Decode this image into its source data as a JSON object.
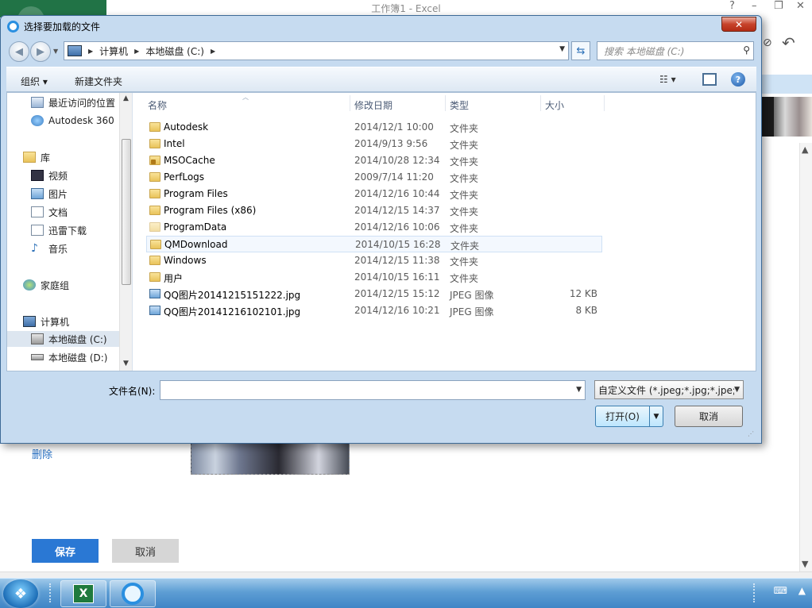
{
  "excel": {
    "title": "工作簿1 - Excel",
    "delete_link": "删除",
    "save_button": "保存",
    "cancel_button": "取消"
  },
  "dialog": {
    "title": "选择要加载的文件",
    "close_glyph": "✕",
    "breadcrumb": [
      "计算机",
      "本地磁盘 (C:)"
    ],
    "search_placeholder": "搜索 本地磁盘 (C:)",
    "toolbar": {
      "organize": "组织 ▾",
      "new_folder": "新建文件夹"
    },
    "nav_items": {
      "recent": "最近访问的位置",
      "autodesk360": "Autodesk 360",
      "libraries": "库",
      "videos": "视频",
      "pictures": "图片",
      "documents": "文档",
      "thunder": "迅雷下载",
      "music": "音乐",
      "homegroup": "家庭组",
      "computer": "计算机",
      "drive_c": "本地磁盘 (C:)",
      "drive_d": "本地磁盘 (D:)"
    },
    "columns": {
      "name": "名称",
      "date": "修改日期",
      "type": "类型",
      "size": "大小"
    },
    "files": [
      {
        "name": "Autodesk",
        "date": "2014/12/1 10:00",
        "type": "文件夹",
        "size": ""
      },
      {
        "name": "Intel",
        "date": "2014/9/13 9:56",
        "type": "文件夹",
        "size": ""
      },
      {
        "name": "MSOCache",
        "date": "2014/10/28 12:34",
        "type": "文件夹",
        "size": ""
      },
      {
        "name": "PerfLogs",
        "date": "2009/7/14 11:20",
        "type": "文件夹",
        "size": ""
      },
      {
        "name": "Program Files",
        "date": "2014/12/16 10:44",
        "type": "文件夹",
        "size": ""
      },
      {
        "name": "Program Files (x86)",
        "date": "2014/12/15 14:37",
        "type": "文件夹",
        "size": ""
      },
      {
        "name": "ProgramData",
        "date": "2014/12/16 10:06",
        "type": "文件夹",
        "size": ""
      },
      {
        "name": "QMDownload",
        "date": "2014/10/15 16:28",
        "type": "文件夹",
        "size": ""
      },
      {
        "name": "Windows",
        "date": "2014/12/15 11:38",
        "type": "文件夹",
        "size": ""
      },
      {
        "name": "用户",
        "date": "2014/10/15 16:11",
        "type": "文件夹",
        "size": ""
      },
      {
        "name": "QQ图片20141215151222.jpg",
        "date": "2014/12/15 15:12",
        "type": "JPEG 图像",
        "size": "12 KB"
      },
      {
        "name": "QQ图片20141216102101.jpg",
        "date": "2014/12/16 10:21",
        "type": "JPEG 图像",
        "size": "8 KB"
      }
    ],
    "filename_label": "文件名(N):",
    "filename_value": "",
    "filetype": "自定义文件 (*.jpeg;*.jpg;*.jpe;",
    "open_button": "打开(O)",
    "cancel_button": "取消"
  },
  "taskbar": {
    "excel_glyph": "X"
  }
}
